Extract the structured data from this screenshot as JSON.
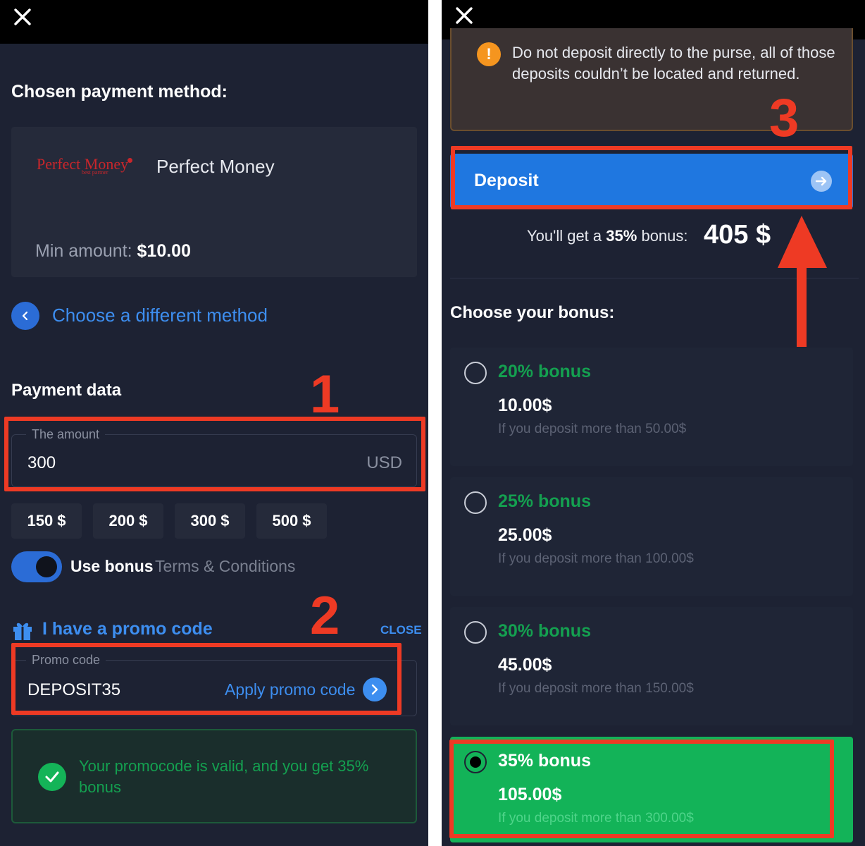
{
  "left_panel": {
    "chosen_title": "Chosen payment method:",
    "method": {
      "logo_text": "Perfect Money",
      "logo_sub": "best partner",
      "name": "Perfect Money",
      "min_label": "Min amount:",
      "min_value": "$10.00"
    },
    "choose_different": "Choose a different method",
    "payment_data_title": "Payment data",
    "amount": {
      "label": "The amount",
      "value": "300",
      "unit": "USD"
    },
    "presets": [
      "150 $",
      "200 $",
      "300 $",
      "500 $"
    ],
    "use_bonus": {
      "label": "Use bonus",
      "terms": "Terms & Conditions",
      "enabled": true
    },
    "promo": {
      "title": "I have a promo code",
      "close": "CLOSE",
      "label": "Promo code",
      "value": "DEPOSIT35",
      "apply": "Apply promo code"
    },
    "valid_message": "Your promocode is valid, and you get 35% bonus"
  },
  "right_panel": {
    "warning": "Do not deposit directly to the purse, all of those deposits couldn’t be located and returned.",
    "deposit_button": "Deposit",
    "bonus_prefix": "You'll get a",
    "bonus_percent": "35%",
    "bonus_suffix": "bonus:",
    "bonus_total": "405 $",
    "choose_bonus_title": "Choose your bonus:",
    "bonuses": [
      {
        "title": "20% bonus",
        "amount": "10.00$",
        "condition": "If you deposit more than 50.00$",
        "selected": false
      },
      {
        "title": "25% bonus",
        "amount": "25.00$",
        "condition": "If you deposit more than 100.00$",
        "selected": false
      },
      {
        "title": "30% bonus",
        "amount": "45.00$",
        "condition": "If you deposit more than 150.00$",
        "selected": false
      },
      {
        "title": "35% bonus",
        "amount": "105.00$",
        "condition": "If you deposit more than 300.00$",
        "selected": true
      }
    ]
  },
  "annotations": {
    "step1": "1",
    "step2": "2",
    "step3": "3"
  },
  "colors": {
    "background": "#1d2233",
    "accent_blue": "#1f77e0",
    "link_blue": "#3d8ef0",
    "success_green": "#13b358",
    "annotation_red": "#ee3a24",
    "warning_orange": "#f5951f"
  }
}
